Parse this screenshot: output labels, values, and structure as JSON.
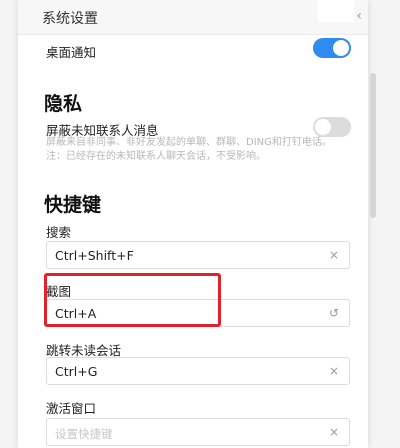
{
  "header": {
    "title": "系统设置",
    "close_glyph": "‹"
  },
  "notifications": {
    "desktop_label": "桌面通知",
    "desktop_enabled": true
  },
  "privacy": {
    "heading": "隐私",
    "block_label": "屏蔽未知联系人消息",
    "block_desc_line1": "屏蔽来自非同事、非好友发起的单聊、群聊、DING和打钉电话。",
    "block_desc_line2": "注：已经存在的未知联系人聊天会话，不受影响。",
    "block_enabled": false
  },
  "shortcuts": {
    "heading": "快捷键",
    "items": [
      {
        "label": "搜索",
        "value": "Ctrl+Shift+F",
        "action_glyph": "×"
      },
      {
        "label": "截图",
        "value": "Ctrl+A",
        "action_glyph": "↺"
      },
      {
        "label": "跳转未读会话",
        "value": "Ctrl+G",
        "action_glyph": "×"
      },
      {
        "label": "激活窗口",
        "placeholder": "设置快捷键",
        "action_glyph": "×"
      }
    ]
  },
  "colors": {
    "toggle_on": "#2e8cf0",
    "highlight": "#e0222b"
  }
}
